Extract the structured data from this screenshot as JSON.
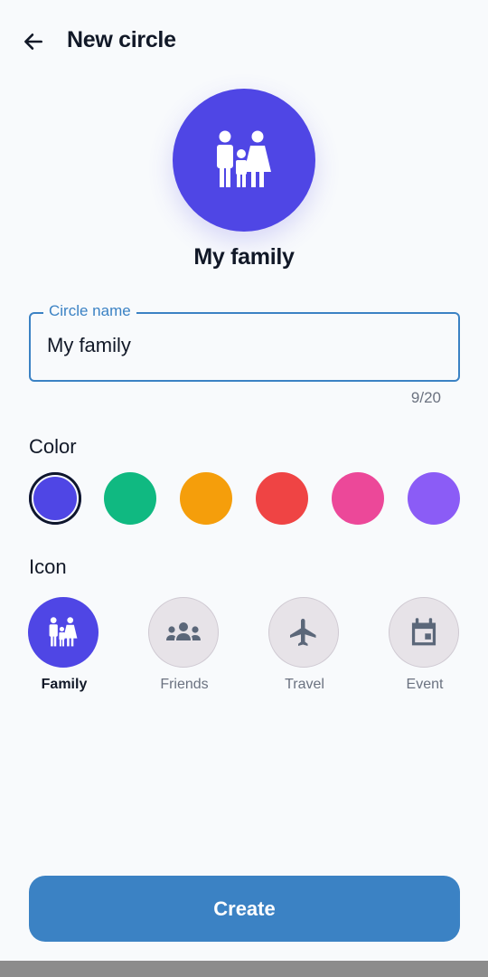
{
  "header": {
    "title": "New circle",
    "back_icon": "arrow-left-icon"
  },
  "avatar": {
    "name": "My family",
    "color": "#4f46e5",
    "icon": "family-icon"
  },
  "name_field": {
    "label": "Circle name",
    "value": "My family",
    "counter": "9/20"
  },
  "color_section": {
    "label": "Color",
    "selected": "#4f46e5",
    "options": [
      "#4f46e5",
      "#10b981",
      "#f59e0b",
      "#ef4444",
      "#ec4899",
      "#8b5cf6"
    ]
  },
  "icon_section": {
    "label": "Icon",
    "selected": "Family",
    "options": [
      {
        "label": "Family",
        "icon": "family-icon"
      },
      {
        "label": "Friends",
        "icon": "groups-icon"
      },
      {
        "label": "Travel",
        "icon": "airplane-icon"
      },
      {
        "label": "Event",
        "icon": "calendar-icon"
      }
    ]
  },
  "footer": {
    "create_label": "Create",
    "accent": "#3b82c4"
  }
}
